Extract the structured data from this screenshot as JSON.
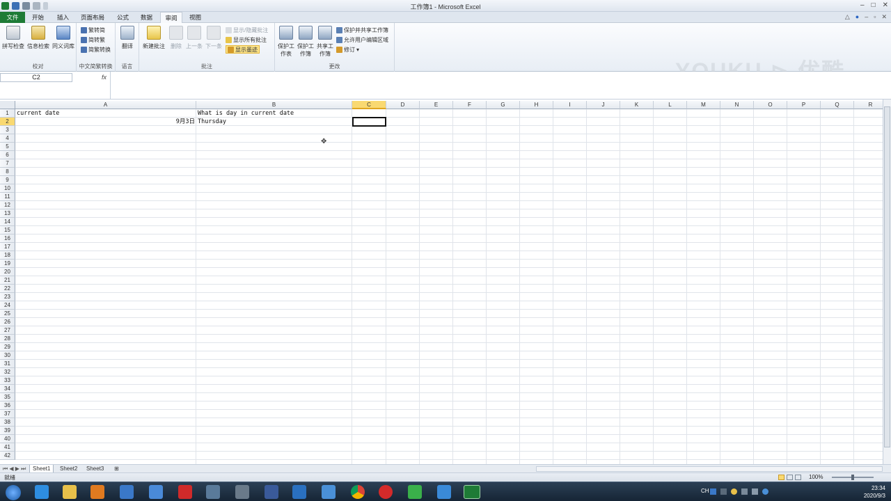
{
  "window": {
    "title": "工作簿1 - Microsoft Excel",
    "minimize": "–",
    "maximize": "□",
    "close": "✕"
  },
  "tabs": [
    "文件",
    "开始",
    "插入",
    "页面布局",
    "公式",
    "数据",
    "审阅",
    "视图"
  ],
  "ribbon": {
    "proofing": {
      "spell": "拼写检查",
      "research": "信息检索",
      "thesaurus": "同义词库",
      "label": "校对"
    },
    "chinese": {
      "t2s": "繁转简",
      "s2t": "简转繁",
      "convert": "简繁转换",
      "label": "中文简繁转换"
    },
    "language": {
      "translate": "翻译",
      "label": "语言"
    },
    "comments": {
      "new": "新建批注",
      "delete": "删除",
      "prev": "上一条",
      "next": "下一条",
      "showhide": "显示/隐藏批注",
      "showall": "显示所有批注",
      "showink": "显示墨迹",
      "label": "批注"
    },
    "changes": {
      "protect_sheet": "保护工作表",
      "protect_wb": "保护工作簿",
      "share_wb": "共享工作簿",
      "protect_share": "保护并共享工作簿",
      "allow_edit": "允许用户编辑区域",
      "track": "修订",
      "label": "更改"
    }
  },
  "watermark": {
    "text": "YOUKU ⊳ 优酷"
  },
  "formula_bar": {
    "name_box": "C2",
    "fx": "fx",
    "content": ""
  },
  "columns": [
    "A",
    "B",
    "C",
    "D",
    "E",
    "F",
    "G",
    "H",
    "I",
    "J",
    "K",
    "L",
    "M",
    "N",
    "O",
    "P",
    "Q",
    "R"
  ],
  "rows": [
    "1",
    "2",
    "3",
    "4",
    "5",
    "6",
    "7",
    "8",
    "9",
    "10",
    "11",
    "12",
    "13",
    "14",
    "15",
    "16",
    "17",
    "18",
    "19",
    "20",
    "21",
    "22",
    "23",
    "24",
    "25",
    "26",
    "27",
    "28",
    "29",
    "30",
    "31",
    "32",
    "33",
    "34",
    "35",
    "36",
    "37",
    "38",
    "39",
    "40",
    "41",
    "42"
  ],
  "cells": {
    "A1": "current date",
    "B1": "What is day in current date",
    "A2": "9月3日",
    "B2": "Thursday"
  },
  "selected_cell": "C2",
  "sheets": [
    "Sheet1",
    "Sheet2",
    "Sheet3"
  ],
  "status": {
    "ready": "就绪",
    "zoom": "100%"
  },
  "taskbar": {
    "ime": "CH",
    "clock_time": "23:34",
    "clock_date": "2020/9/3"
  },
  "colors": {
    "excel_green": "#1e7b36",
    "selected_header": "#f9d971",
    "taskbar": "#1d2f43"
  }
}
